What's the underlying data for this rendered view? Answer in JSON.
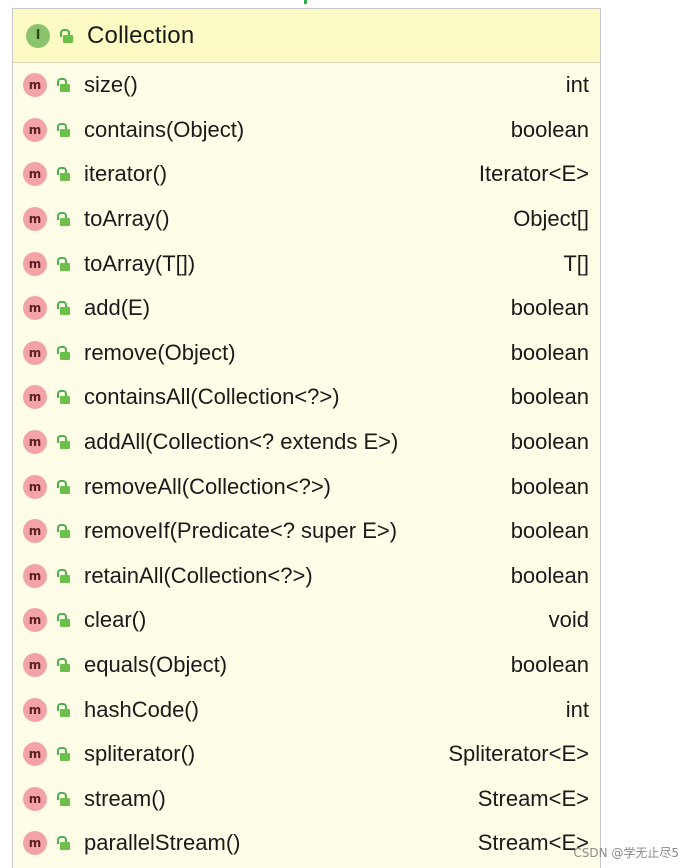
{
  "panel": {
    "title": "Collection",
    "title_icon": "interface-icon",
    "title_badge": "I"
  },
  "members": [
    {
      "badge": "m",
      "name": "size()",
      "type": "int"
    },
    {
      "badge": "m",
      "name": "contains(Object)",
      "type": "boolean"
    },
    {
      "badge": "m",
      "name": "iterator()",
      "type": "Iterator<E>"
    },
    {
      "badge": "m",
      "name": "toArray()",
      "type": "Object[]"
    },
    {
      "badge": "m",
      "name": "toArray(T[])",
      "type": "T[]"
    },
    {
      "badge": "m",
      "name": "add(E)",
      "type": "boolean"
    },
    {
      "badge": "m",
      "name": "remove(Object)",
      "type": "boolean"
    },
    {
      "badge": "m",
      "name": "containsAll(Collection<?>)",
      "type": "boolean"
    },
    {
      "badge": "m",
      "name": "addAll(Collection<? extends E>)",
      "type": "boolean"
    },
    {
      "badge": "m",
      "name": "removeAll(Collection<?>)",
      "type": "boolean"
    },
    {
      "badge": "m",
      "name": "removeIf(Predicate<? super E>)",
      "type": "boolean"
    },
    {
      "badge": "m",
      "name": "retainAll(Collection<?>)",
      "type": "boolean"
    },
    {
      "badge": "m",
      "name": "clear()",
      "type": "void"
    },
    {
      "badge": "m",
      "name": "equals(Object)",
      "type": "boolean"
    },
    {
      "badge": "m",
      "name": "hashCode()",
      "type": "int"
    },
    {
      "badge": "m",
      "name": "spliterator()",
      "type": "Spliterator<E>"
    },
    {
      "badge": "m",
      "name": "stream()",
      "type": "Stream<E>"
    },
    {
      "badge": "m",
      "name": "parallelStream()",
      "type": "Stream<E>"
    }
  ],
  "icons": {
    "member": "method-icon",
    "visibility": "public-lock-icon"
  },
  "colors": {
    "header_bg": "#fcfbc3",
    "panel_bg": "#fffde8",
    "interface_badge": "#8cc46e",
    "method_badge": "#f3a3a6",
    "lock": "#6cc04a"
  },
  "watermark": "CSDN @学无止尽5"
}
